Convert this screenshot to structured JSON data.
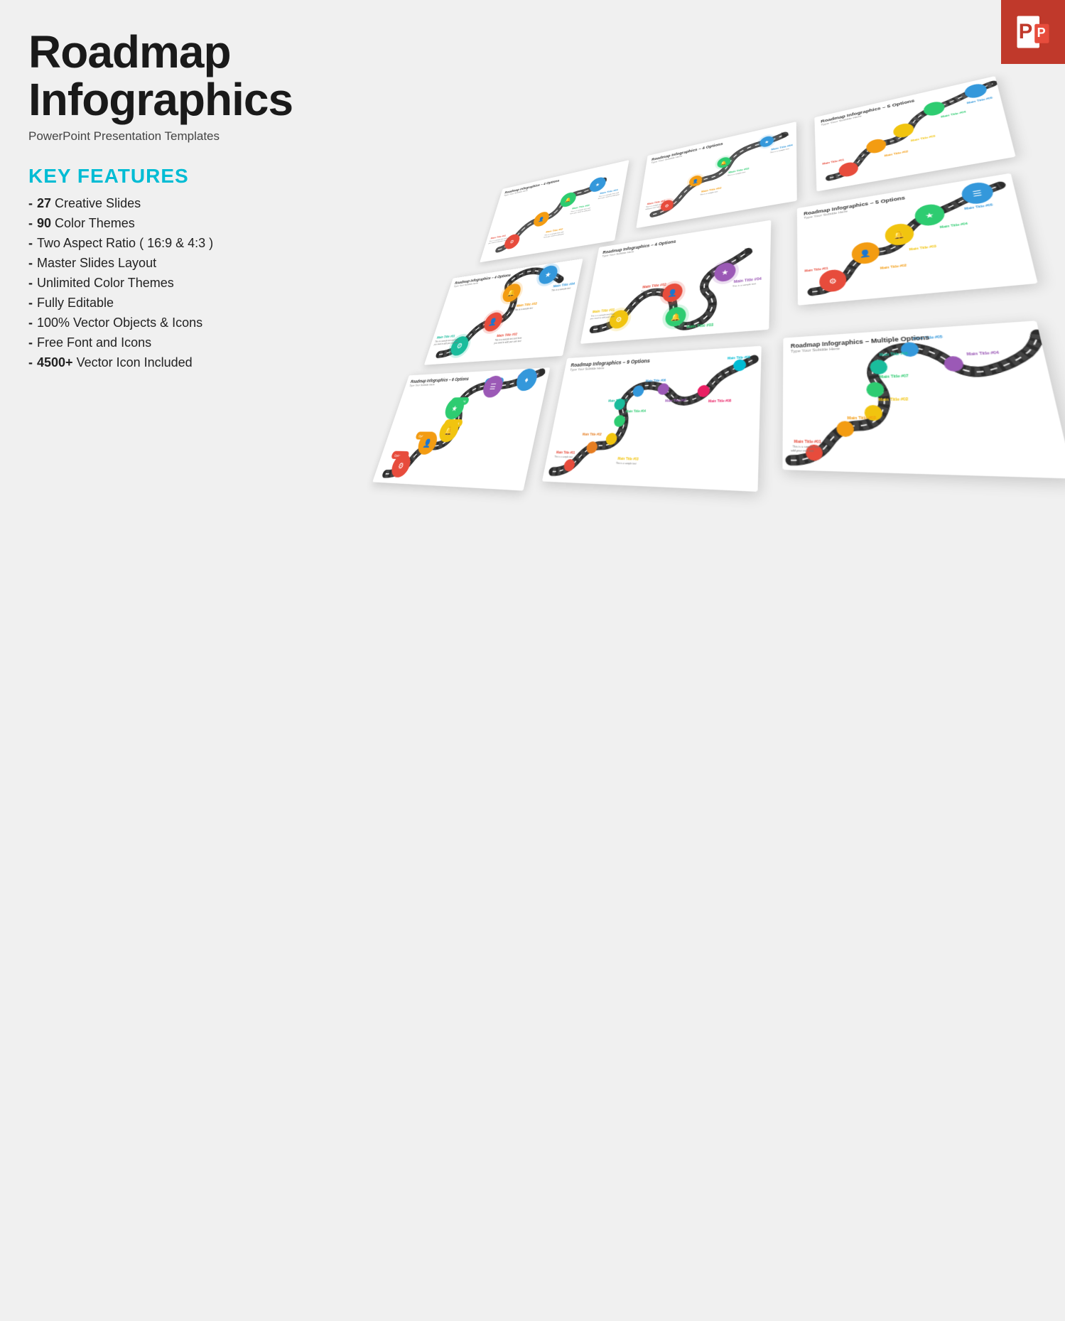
{
  "page": {
    "background_color": "#efefef"
  },
  "header": {
    "title": "Roadmap Infographics",
    "subtitle": "PowerPoint Presentation Templates"
  },
  "features_section": {
    "label": "KEY FEATURES",
    "items": [
      {
        "bold": "27",
        "text": " Creative Slides"
      },
      {
        "bold": "90",
        "text": " Color Themes"
      },
      {
        "bold": "",
        "text": "Two Aspect Ratio ( 16:9 & 4:3 )"
      },
      {
        "bold": "",
        "text": "Master Slides Layout"
      },
      {
        "bold": "",
        "text": "Unlimited Color Themes"
      },
      {
        "bold": "",
        "text": "Fully Editable"
      },
      {
        "bold": "",
        "text": "100% Vector Objects & Icons"
      },
      {
        "bold": "",
        "text": "Free Font and Icons"
      },
      {
        "bold": "4500+",
        "text": " Vector Icon Included"
      }
    ]
  },
  "slides": [
    {
      "id": 1,
      "title": "Roadmap Infographics – 4 Options",
      "subtitle": "Type Your Subtitle Here",
      "options": 4
    },
    {
      "id": 2,
      "title": "Roadmap Infographics – 4 Options",
      "subtitle": "Type Your Subtitle Here",
      "options": 4
    },
    {
      "id": 3,
      "title": "Roadmap Infographics – 5 Options",
      "subtitle": "Type Your Subtitle Here",
      "options": 5
    },
    {
      "id": 4,
      "title": "Roadmap Infographics – 4 Options",
      "subtitle": "Type Your Subtitle Here",
      "options": 4
    },
    {
      "id": 5,
      "title": "Roadmap Infographics – 4 Options",
      "subtitle": "Type Your Subtitle Here",
      "options": 4
    },
    {
      "id": 6,
      "title": "Roadmap Infographics – 5 Options",
      "subtitle": "Type Your Subtitle Here",
      "options": 5
    },
    {
      "id": 7,
      "title": "Roadmap Infographics – 6 Options",
      "subtitle": "Type Your Subtitle Here",
      "options": 6
    },
    {
      "id": 8,
      "title": "Roadmap Infographics – 9 Options",
      "subtitle": "Type Your Subtitle Here",
      "options": 9
    },
    {
      "id": 9,
      "title": "Roadmap Infographics – Multiple Options",
      "subtitle": "Type Your Subtitle Here",
      "options": 7
    }
  ],
  "ppt_badge": {
    "label": "P"
  },
  "colors": {
    "accent": "#00bcd4",
    "title": "#1a1a1a",
    "badge_bg": "#c0392b",
    "node_colors": [
      "#e74c3c",
      "#e67e22",
      "#f1c40f",
      "#2ecc71",
      "#1abc9c",
      "#3498db",
      "#9b59b6",
      "#e91e63",
      "#00bcd4"
    ]
  }
}
